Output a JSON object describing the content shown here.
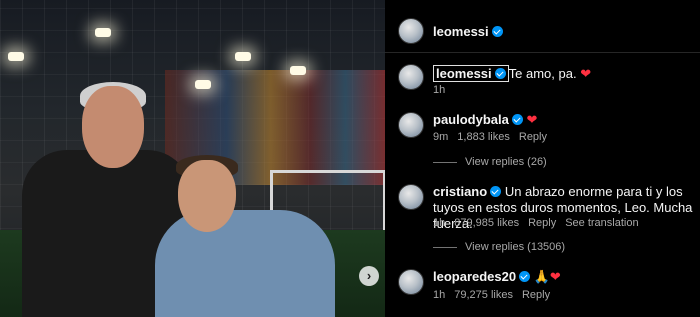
{
  "post": {
    "author": "leomessi",
    "next_icon": "chevron-right-icon"
  },
  "comments": [
    {
      "user": "leomessi",
      "text": "Te amo, pa.",
      "emoji": "❤",
      "time": "1h"
    },
    {
      "user": "paulodybala",
      "text": "",
      "emoji": "❤",
      "time": "9m",
      "likes": "1,883 likes",
      "reply": "Reply",
      "view_replies": "View replies (26)"
    },
    {
      "user": "cristiano",
      "text": "Un abrazo enorme para ti y los tuyos en estos duros momentos, Leo. Mucha fuerza.",
      "emoji": "",
      "time": "1h",
      "likes": "879,985 likes",
      "reply": "Reply",
      "translation": "See translation",
      "view_replies": "View replies (13506)"
    },
    {
      "user": "leoparedes20",
      "text": "",
      "emoji": "🙏❤",
      "time": "1h",
      "likes": "79,275 likes",
      "reply": "Reply"
    }
  ],
  "colors": {
    "verified": "#0095f6",
    "heart": "#ff3040",
    "muted": "#a8a8a8"
  }
}
